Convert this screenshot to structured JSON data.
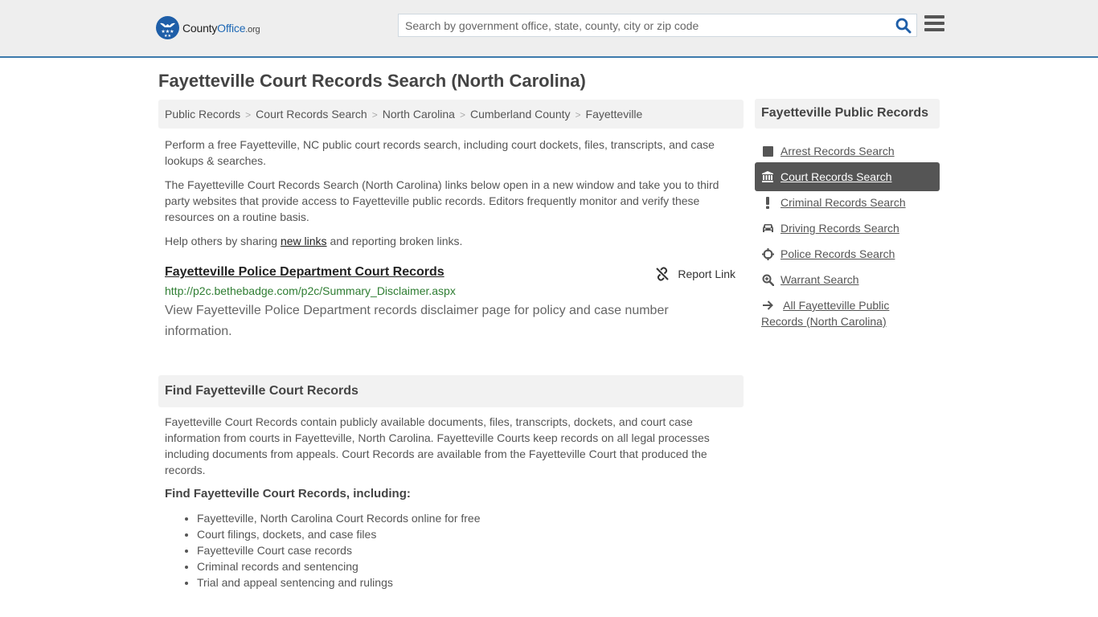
{
  "header": {
    "logo": {
      "name_part1": "County",
      "name_part2": "Office",
      "tld": ".org"
    },
    "search": {
      "placeholder": "Search by government office, state, county, city or zip code",
      "value": ""
    },
    "colors": {
      "brand": "#1e68b5",
      "topbar_border": "#3c7aab"
    }
  },
  "page": {
    "title": "Fayetteville Court Records Search (North Carolina)"
  },
  "breadcrumb": [
    {
      "label": "Public Records"
    },
    {
      "label": "Court Records Search"
    },
    {
      "label": "North Carolina"
    },
    {
      "label": "Cumberland County"
    },
    {
      "label": "Fayetteville"
    }
  ],
  "breadcrumb_separator": ">",
  "intro": {
    "p1": "Perform a free Fayetteville, NC public court records search, including court dockets, files, transcripts, and case lookups & searches.",
    "p2": "The Fayetteville Court Records Search (North Carolina) links below open in a new window and take you to third party websites that provide access to Fayetteville public records. Editors frequently monitor and verify these resources on a routine basis.",
    "p3_before": "Help others by sharing ",
    "p3_link": "new links",
    "p3_after": " and reporting broken links."
  },
  "results": [
    {
      "title": "Fayetteville Police Department Court Records",
      "url": "http://p2c.bethebadge.com/p2c/Summary_Disclaimer.aspx",
      "description": "View Fayetteville Police Department records disclaimer page for policy and case number information.",
      "report_label": "Report Link"
    }
  ],
  "find_section": {
    "heading": "Find Fayetteville Court Records",
    "body": "Fayetteville Court Records contain publicly available documents, files, transcripts, dockets, and court case information from courts in Fayetteville, North Carolina. Fayetteville Courts keep records on all legal processes including documents from appeals. Court Records are available from the Fayetteville Court that produced the records.",
    "subheading": "Find Fayetteville Court Records, including:",
    "bullets": [
      "Fayetteville, North Carolina Court Records online for free",
      "Court filings, dockets, and case files",
      "Fayetteville Court case records",
      "Criminal records and sentencing",
      "Trial and appeal sentencing and rulings"
    ]
  },
  "sidebar": {
    "heading": "Fayetteville Public Records",
    "items": [
      {
        "label": "Arrest Records Search",
        "icon": "square-icon",
        "active": false
      },
      {
        "label": "Court Records Search",
        "icon": "courthouse-icon",
        "active": true
      },
      {
        "label": "Criminal Records Search",
        "icon": "exclamation-icon",
        "active": false
      },
      {
        "label": "Driving Records Search",
        "icon": "car-icon",
        "active": false
      },
      {
        "label": "Police Records Search",
        "icon": "crosshairs-icon",
        "active": false
      },
      {
        "label": "Warrant Search",
        "icon": "search-plus-icon",
        "active": false
      },
      {
        "label": "All Fayetteville Public Records (North Carolina)",
        "icon": "arrow-right-icon",
        "active": false
      }
    ]
  }
}
